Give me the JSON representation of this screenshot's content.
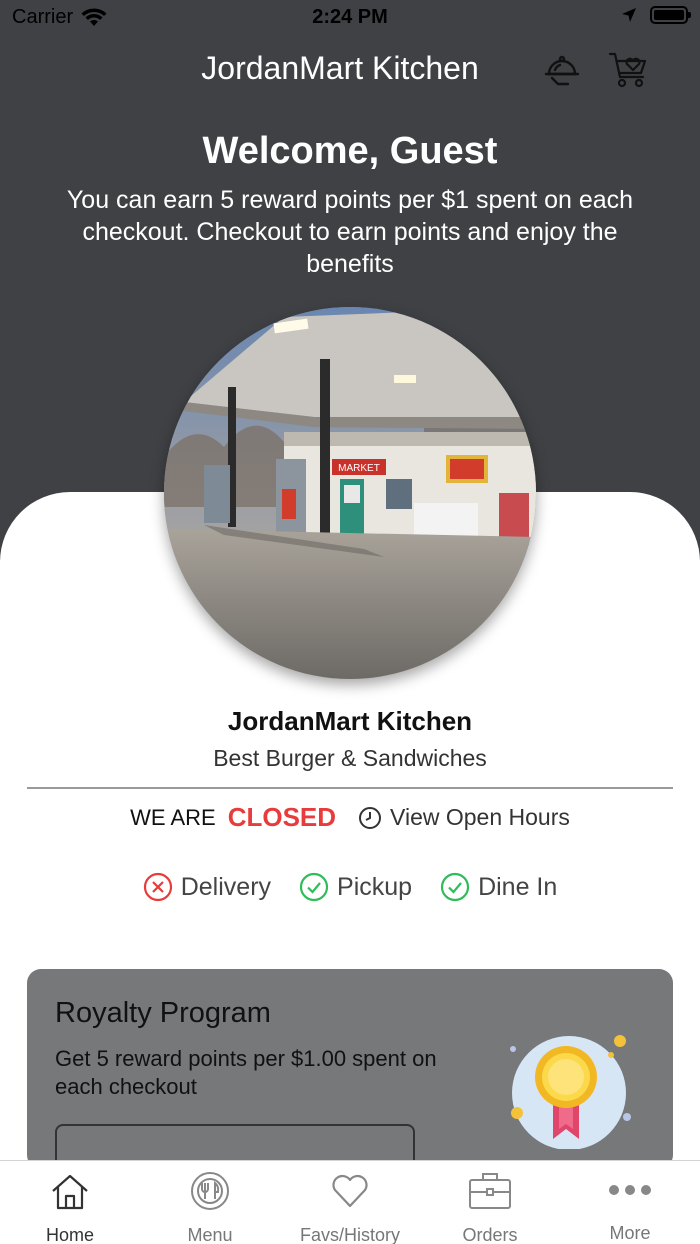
{
  "status_bar": {
    "carrier": "Carrier",
    "time": "2:24 PM"
  },
  "header": {
    "title": "JordanMart Kitchen",
    "icons": [
      "cloche-icon",
      "cart-heart-icon"
    ]
  },
  "welcome": {
    "title": "Welcome, Guest",
    "text": "You can earn 5 reward points per $1 spent on each checkout. Checkout to earn points and enjoy the benefits"
  },
  "store": {
    "name": "JordanMart Kitchen",
    "tagline": "Best Burger & Sandwiches",
    "photo": "gas station storefront",
    "sign_text": "MARKET"
  },
  "status": {
    "prefix": "WE ARE",
    "state": "CLOSED",
    "state_color": "#e83c3c",
    "hours_label": "View Open Hours"
  },
  "services": [
    {
      "label": "Delivery",
      "available": false,
      "color": "#e83c3c"
    },
    {
      "label": "Pickup",
      "available": true,
      "color": "#2ebd59"
    },
    {
      "label": "Dine In",
      "available": true,
      "color": "#2ebd59"
    }
  ],
  "royalty": {
    "title": "Royalty Program",
    "text": "Get 5 reward points per $1.00 spent on each checkout",
    "badge_icon": "award-ribbon-icon"
  },
  "tabs": [
    {
      "label": "Home",
      "icon": "home-icon",
      "active": true
    },
    {
      "label": "Menu",
      "icon": "menu-plate-icon",
      "active": false
    },
    {
      "label": "Favs/History",
      "icon": "heart-icon",
      "active": false
    },
    {
      "label": "Orders",
      "icon": "briefcase-icon",
      "active": false
    },
    {
      "label": "More",
      "icon": "more-dots-icon",
      "active": false
    }
  ],
  "colors": {
    "header_bg": "#3f4144",
    "card_bg": "#76787a",
    "closed": "#e83c3c",
    "available": "#2ebd59"
  }
}
